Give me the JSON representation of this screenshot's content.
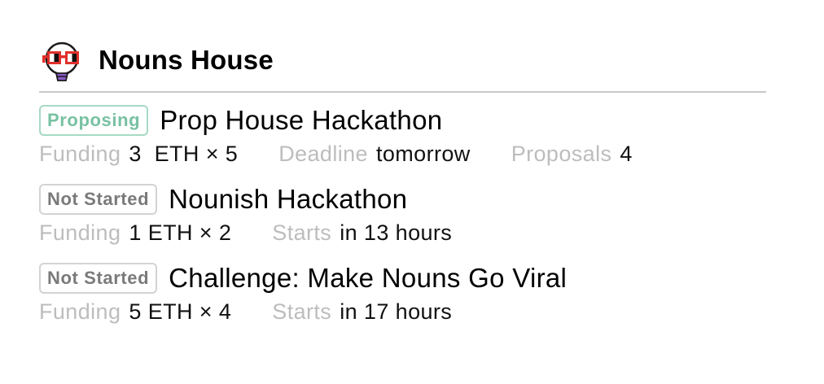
{
  "house": {
    "name": "Nouns House",
    "logo_icon": "nouns-glasses-lightbulb-icon"
  },
  "colors": {
    "proposing_badge": "#78c1a3",
    "not_started_badge": "#7a7a7a",
    "meta_label": "#bdbdbd",
    "divider": "#c9c9c9"
  },
  "rounds": [
    {
      "status": "Proposing",
      "title": "Prop House Hackathon",
      "funding_label": "Funding",
      "funding_value": "3  ETH × 5",
      "time_label": "Deadline",
      "time_value": "tomorrow",
      "proposals_label": "Proposals",
      "proposals_value": "4"
    },
    {
      "status": "Not Started",
      "title": "Nounish Hackathon",
      "funding_label": "Funding",
      "funding_value": "1 ETH × 2",
      "time_label": "Starts",
      "time_value": "in 13 hours"
    },
    {
      "status": "Not Started",
      "title": "Challenge: Make Nouns Go Viral",
      "funding_label": "Funding",
      "funding_value": "5 ETH × 4",
      "time_label": "Starts",
      "time_value": "in 17 hours"
    }
  ]
}
